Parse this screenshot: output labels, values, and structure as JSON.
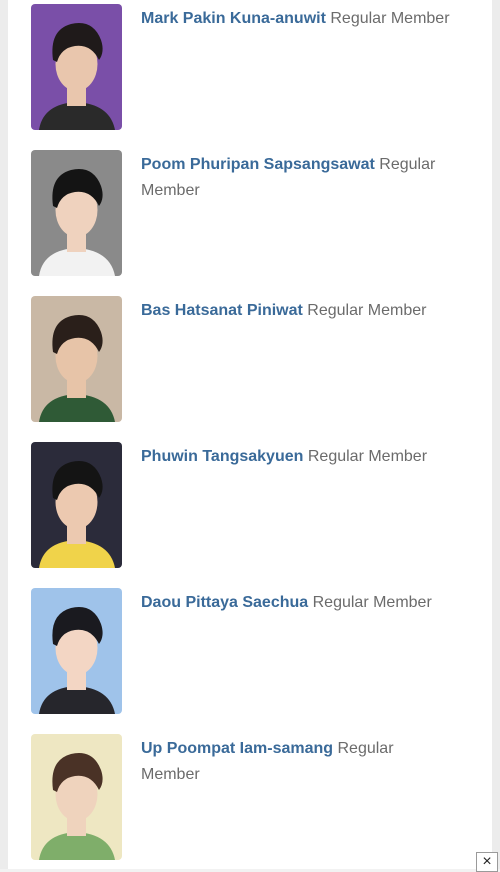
{
  "members": [
    {
      "name": "Mark Pakin Kuna-anuwit",
      "role": "Regular Member",
      "photo_bg": "#7a4fa8",
      "skin": "#e9c6ad",
      "hair": "#1f1a1a",
      "shirt": "#2a2a2a"
    },
    {
      "name": "Poom Phuripan Sapsangsawat",
      "role": "Regular Member",
      "photo_bg": "#8a8a8a",
      "skin": "#efd2be",
      "hair": "#141414",
      "shirt": "#f2f2f2"
    },
    {
      "name": "Bas Hatsanat Piniwat",
      "role": "Regular Member",
      "photo_bg": "#c9b8a5",
      "skin": "#e7c4a8",
      "hair": "#2a1f1a",
      "shirt": "#2f5a36"
    },
    {
      "name": "Phuwin Tangsakyuen",
      "role": "Regular Member",
      "photo_bg": "#2b2b3a",
      "skin": "#ecc9b0",
      "hair": "#141414",
      "shirt": "#f0d34a"
    },
    {
      "name": "Daou Pittaya Saechua",
      "role": "Regular Member",
      "photo_bg": "#9fc3ea",
      "skin": "#f3d6c4",
      "hair": "#1a1a1f",
      "shirt": "#26262c"
    },
    {
      "name": "Up Poompat Iam-samang",
      "role": "Regular Member",
      "photo_bg": "#eee7c2",
      "skin": "#efd3bd",
      "hair": "#4a3226",
      "shirt": "#7fae6a"
    }
  ],
  "close_label": "×"
}
